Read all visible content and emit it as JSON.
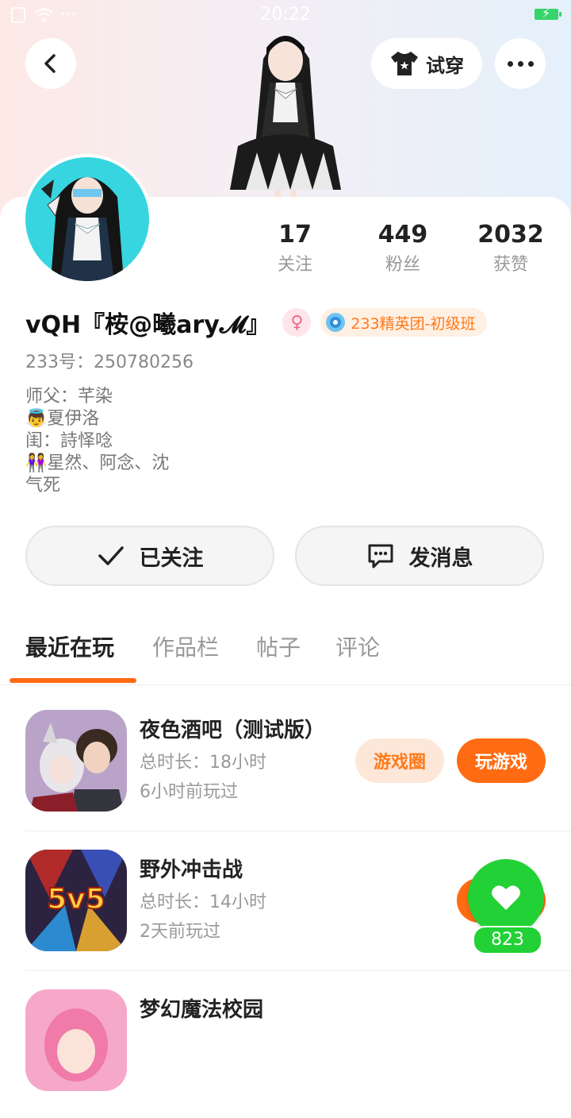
{
  "status_bar": {
    "time": "20:22"
  },
  "header": {
    "tryon_label": "试穿"
  },
  "profile": {
    "stats": [
      {
        "value": "17",
        "label": "关注"
      },
      {
        "value": "449",
        "label": "粉丝"
      },
      {
        "value": "2032",
        "label": "获赞"
      }
    ],
    "name": "vQH『桉@曦ary𝓜』",
    "badge": "233精英团-初级班",
    "uid": "233号：250780256",
    "bio": [
      "师父：芊染",
      "👼夏伊洛",
      "闺：詩怿唸",
      "👭星然、阿念、沈",
      "气死"
    ]
  },
  "actions": {
    "follow": "已关注",
    "message": "发消息"
  },
  "tabs": [
    "最近在玩",
    "作品栏",
    "帖子",
    "评论"
  ],
  "games": [
    {
      "title": "夜色酒吧（测试版）",
      "duration": "总时长：18小时",
      "last_played": "6小时前玩过",
      "circle_label": "游戏圈",
      "play_label": "玩游戏"
    },
    {
      "title": "野外冲击战",
      "duration": "总时长：14小时",
      "last_played": "2天前玩过",
      "icon_text": "5v5"
    },
    {
      "title": "梦幻魔法校园"
    }
  ],
  "like_float": {
    "count": "823"
  },
  "colors": {
    "accent": "#ff6b12",
    "like_green": "#22d135"
  }
}
